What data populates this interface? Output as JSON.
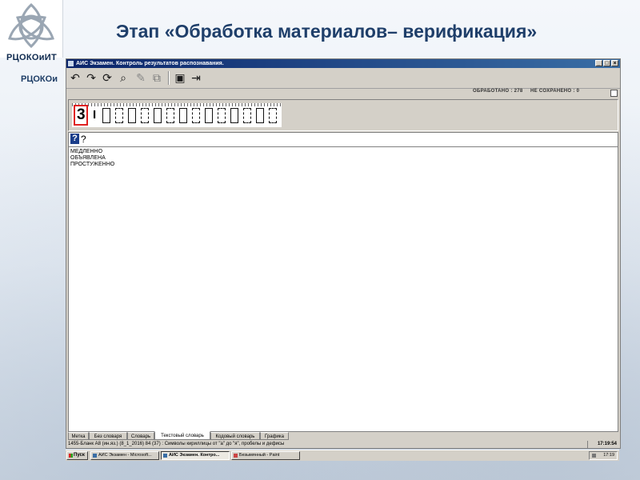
{
  "slide": {
    "title": "Этап «Обработка материалов– верификация»",
    "logo_text": "РЦОКОиИТ",
    "logo_text_shadow": "РЦОКОи"
  },
  "app": {
    "window_title": "АИС Экзамен. Контроль результатов распознавания.",
    "window_buttons": [
      "_",
      "□",
      "×"
    ],
    "toolbar_icons": [
      "undo-icon",
      "redo-icon",
      "refresh-icon",
      "zoom-icon",
      "edit-icon",
      "copy-icon",
      "save-icon",
      "exit-icon"
    ],
    "stats": {
      "processed": "ОБРАБОТАНО : 278",
      "not_saved": "НЕ СОХРАНЕНО : 0"
    },
    "scan": {
      "digit": "3",
      "glyph": "I"
    },
    "input": {
      "icon": "?",
      "value": "?"
    },
    "list_items": [
      "МЕДЛЕННО",
      "ОБЪЯВЛЕНА",
      "ПРОСТУЖЕННО"
    ],
    "tabs": [
      "Метка",
      "Без словаря",
      "Словарь",
      "Текстовый словарь",
      "Кодовый словарь",
      "Графика"
    ],
    "active_tab": "Текстовый словарь",
    "status": {
      "text": "1455-Бланк А8 (ин.яз.) (8_1_2016)    84 (37) : Символы кириллицы от \"а\" до \"я\", пробелы и дефисы",
      "time": "17:19:54"
    }
  },
  "taskbar": {
    "start": "Пуск",
    "tasks": [
      "АИС Экзамен - Microsoft...",
      "АИС Экзамен. Контро...",
      "Безымянный - Paint"
    ],
    "active_task": 1,
    "clock": "17:19"
  }
}
